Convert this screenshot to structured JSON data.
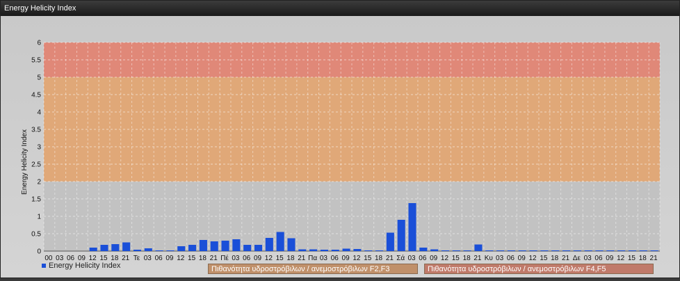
{
  "window": {
    "title": "Energy Helicity Index"
  },
  "colors": {
    "bar": "#1a4fd8",
    "band_low": "#c2c2c2",
    "band_mid": "#e0a878",
    "band_high": "#e08878"
  },
  "chart_data": {
    "type": "bar",
    "ylabel": "Energy Helicity Index",
    "ylim": [
      0,
      6
    ],
    "yticks": [
      "0",
      "0.5",
      "1",
      "1.5",
      "2",
      "2.5",
      "3",
      "3.5",
      "4",
      "4.5",
      "5",
      "5.5",
      "6"
    ],
    "bands": [
      {
        "from": 0,
        "to": 2,
        "color": "#c2c2c2"
      },
      {
        "from": 2,
        "to": 5,
        "color": "#e0a878"
      },
      {
        "from": 5,
        "to": 6,
        "color": "#e08878"
      }
    ],
    "categories": [
      "00",
      "03",
      "06",
      "09",
      "12",
      "15",
      "18",
      "21",
      "Τε",
      "03",
      "06",
      "09",
      "12",
      "15",
      "18",
      "21",
      "Πέ",
      "03",
      "06",
      "09",
      "12",
      "15",
      "18",
      "21",
      "Πα",
      "03",
      "06",
      "09",
      "12",
      "15",
      "18",
      "21",
      "Σά",
      "03",
      "06",
      "09",
      "12",
      "15",
      "18",
      "21",
      "Κυ",
      "03",
      "06",
      "09",
      "12",
      "15",
      "18",
      "21",
      "Δε",
      "03",
      "06",
      "09",
      "12",
      "15",
      "18",
      "21"
    ],
    "series": [
      {
        "name": "Energy Helicity Index",
        "values": [
          0,
          0,
          0,
          0,
          0.1,
          0.18,
          0.2,
          0.25,
          0.04,
          0.08,
          0.01,
          0.01,
          0.14,
          0.18,
          0.32,
          0.28,
          0.3,
          0.34,
          0.18,
          0.18,
          0.38,
          0.55,
          0.37,
          0.05,
          0.05,
          0.04,
          0.04,
          0.07,
          0.06,
          0.02,
          0.02,
          0.53,
          0.9,
          1.38,
          0.1,
          0.05,
          0.01,
          0.01,
          0.01,
          0.19,
          0.01,
          0.01,
          0.01,
          0.01,
          0.01,
          0.01,
          0.02,
          0.02,
          0.01,
          0.02,
          0.01,
          0.01,
          0.01,
          0.01,
          0.01,
          0.02
        ]
      }
    ]
  },
  "legend": {
    "label": "Energy Helicity Index"
  },
  "band_labels": {
    "f2f3": "Πιθανότητα υδροστρόβιλων / ανεμοστρόβιλων F2,F3",
    "f4f5": "Πιθανότητα υδροστρόβιλων / ανεμοστρόβιλων F4,F5"
  }
}
